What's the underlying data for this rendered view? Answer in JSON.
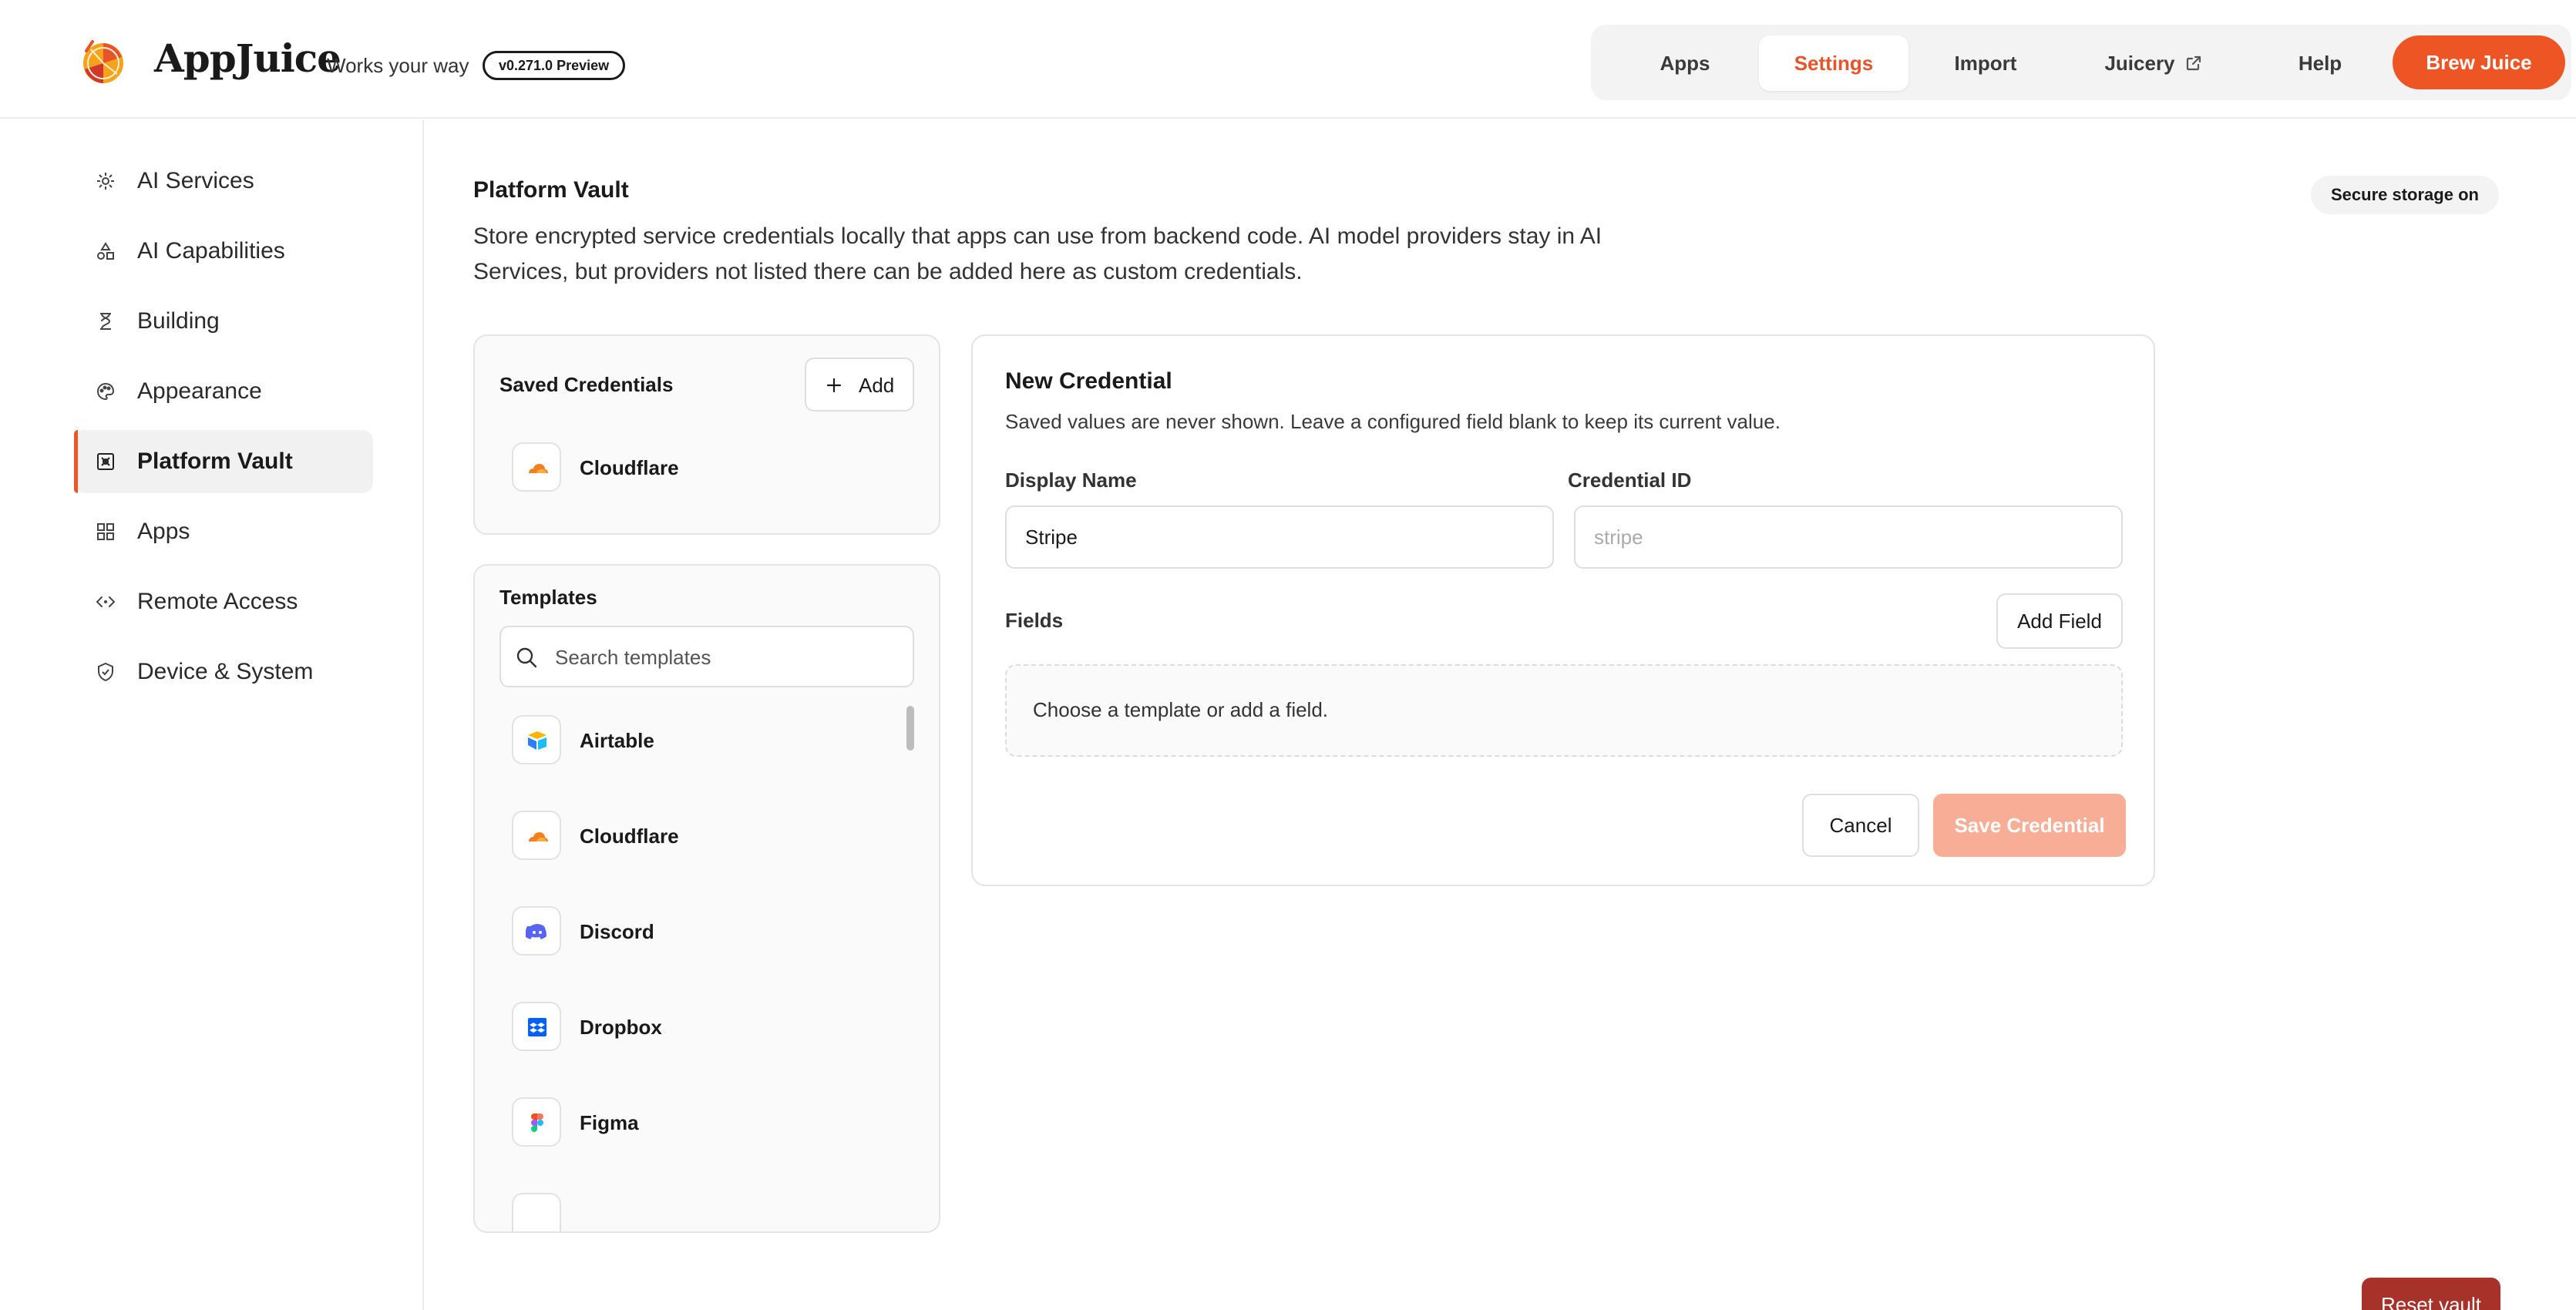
{
  "header": {
    "brand": "AppJuice",
    "tagline": "Works your way",
    "version": "v0.271.0 Preview",
    "nav": [
      {
        "label": "Apps"
      },
      {
        "label": "Settings"
      },
      {
        "label": "Import"
      },
      {
        "label": "Juicery"
      },
      {
        "label": "Help"
      }
    ],
    "cta": "Brew Juice",
    "accent_color": "#ee5524"
  },
  "sidebar": {
    "active": "Platform Vault",
    "items": [
      {
        "label": "AI Services",
        "icon": "gear-icon"
      },
      {
        "label": "AI Capabilities",
        "icon": "shapes-icon"
      },
      {
        "label": "Building",
        "icon": "hourglass-icon"
      },
      {
        "label": "Appearance",
        "icon": "palette-icon"
      },
      {
        "label": "Platform Vault",
        "icon": "vault-icon"
      },
      {
        "label": "Apps",
        "icon": "grid-icon"
      },
      {
        "label": "Remote Access",
        "icon": "code-icon"
      },
      {
        "label": "Device & System",
        "icon": "shield-icon"
      }
    ]
  },
  "main": {
    "title": "Platform Vault",
    "badge": "Secure storage on",
    "description": "Store encrypted service credentials locally that apps can use from backend code. AI model providers stay in AI Services, but providers not listed there can be added here as custom credentials."
  },
  "saved": {
    "title": "Saved Credentials",
    "add_label": "Add",
    "items": [
      {
        "name": "Cloudflare",
        "icon": "cloudflare-icon"
      }
    ]
  },
  "templates": {
    "title": "Templates",
    "search_placeholder": "Search templates",
    "items": [
      {
        "name": "Airtable",
        "icon": "airtable-icon"
      },
      {
        "name": "Cloudflare",
        "icon": "cloudflare-icon"
      },
      {
        "name": "Discord",
        "icon": "discord-icon"
      },
      {
        "name": "Dropbox",
        "icon": "dropbox-icon"
      },
      {
        "name": "Figma",
        "icon": "figma-icon"
      }
    ]
  },
  "form": {
    "title": "New Credential",
    "description": "Saved values are never shown. Leave a configured field blank to keep its current value.",
    "display_name_label": "Display Name",
    "display_name_value": "Stripe",
    "credential_id_label": "Credential ID",
    "credential_id_placeholder": "stripe",
    "fields_label": "Fields",
    "add_field_label": "Add Field",
    "empty_text": "Choose a template or add a field.",
    "cancel_label": "Cancel",
    "save_label": "Save Credential"
  },
  "footer": {
    "reset_label": "Reset vault"
  }
}
